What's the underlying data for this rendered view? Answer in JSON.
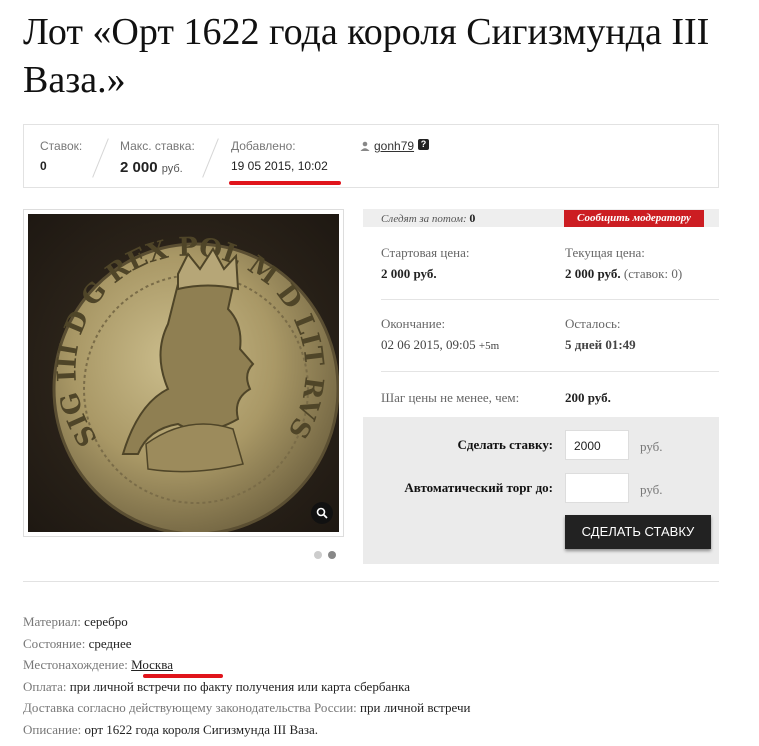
{
  "page": {
    "title": "Лот «Орт 1622 года короля Сигизмунда III Ваза.»"
  },
  "stats": {
    "bids_label": "Ставок:",
    "bids_value": "0",
    "max_bid_label": "Макс. ставка:",
    "max_bid_value": "2 000",
    "max_bid_unit": "руб.",
    "added_label": "Добавлено:",
    "added_value": "19 05 2015, 10:02",
    "seller_name": "gonh79",
    "seller_help": "?"
  },
  "gallery": {
    "coin_legend": "SIG III D G REX POL M D LIT RVS PR",
    "zoom_icon": "magnifier-icon",
    "dots": 2,
    "active_dot": 2
  },
  "auction": {
    "watch_label": "Следят за потом:",
    "watch_count": "0",
    "report_button": "Сообщить модератору",
    "start_price_label": "Стартовая цена:",
    "start_price_value": "2 000 руб.",
    "current_price_label": "Текущая цена:",
    "current_price_value": "2 000 руб.",
    "current_price_note": "(ставок: 0)",
    "end_label": "Окончание:",
    "end_value": "02 06 2015, 09:05",
    "end_tz": "+5m",
    "remaining_label": "Осталось:",
    "remaining_value": "5 дней 01:49",
    "step_label": "Шаг цены не менее, чем:",
    "step_value": "200 руб."
  },
  "bid_form": {
    "bid_label": "Сделать ставку:",
    "bid_value": "2000",
    "bid_unit": "руб.",
    "auto_label": "Автоматический торг до:",
    "auto_value": "",
    "auto_unit": "руб.",
    "submit_button": "СДЕЛАТЬ СТАВКУ"
  },
  "properties": [
    {
      "key": "Материал:",
      "value": "серебро"
    },
    {
      "key": "Состояние:",
      "value": "среднее"
    },
    {
      "key": "Местонахождение:",
      "value": "Москва"
    },
    {
      "key": "Оплата:",
      "value": "при личной встречи по факту получения или карта сбербанка"
    },
    {
      "key": "Доставка согласно действующему законодательства России:",
      "value": "при личной встречи"
    },
    {
      "key": "Описание:",
      "value": "орт 1622 года короля Сигизмунда III Ваза."
    }
  ],
  "colors": {
    "accent_red": "#cc1d22",
    "underline_red": "#e0141b",
    "button_dark": "#222222",
    "bid_box_bg": "#ebebeb"
  }
}
